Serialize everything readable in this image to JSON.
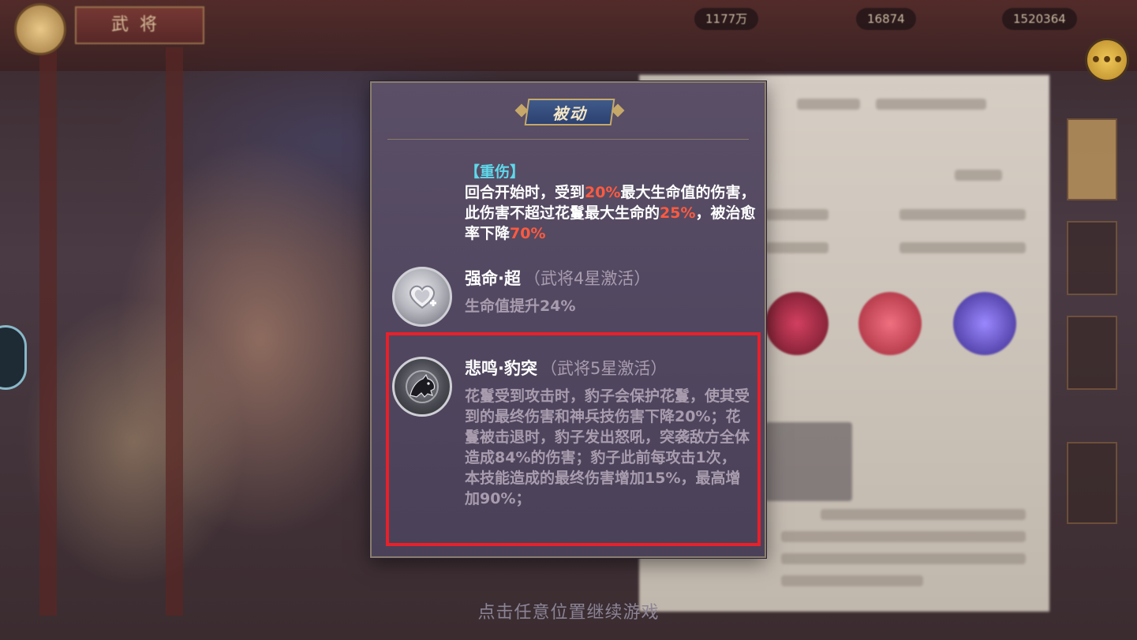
{
  "background": {
    "title_banner": "武将",
    "resources": [
      "1177万",
      "16874",
      "1520364"
    ],
    "hint": "点击任意位置继续游戏"
  },
  "modal": {
    "title": "被动",
    "skill": {
      "tag": "【重伤】",
      "desc_parts": [
        {
          "text": "回合开始时，受到",
          "color": "white"
        },
        {
          "text": "20%",
          "color": "red"
        },
        {
          "text": "最大生命值的伤害，此伤害不超过花鬘最大生命的",
          "color": "white"
        },
        {
          "text": "25%",
          "color": "red"
        },
        {
          "text": "，被治愈率下降",
          "color": "white"
        },
        {
          "text": "70%",
          "color": "red"
        }
      ]
    },
    "entries": [
      {
        "name": "强命·超",
        "condition": "（武将4星激活）",
        "description": "生命值提升24%",
        "icon": "heart-plus-icon"
      },
      {
        "name": "悲鸣·豹突",
        "condition": "（武将5星激活）",
        "description": "花鬘受到攻击时，豹子会保护花鬘，使其受到的最终伤害和神兵技伤害下降20%；花鬘被击退时，豹子发出怒吼，突袭敌方全体造成84%的伤害；豹子此前每攻击1次，本技能造成的最终伤害增加15%，最高增加90%；",
        "icon": "leopard-icon"
      }
    ]
  },
  "colors": {
    "accent_cyan": "#5fd8ea",
    "highlight_red": "#ff5a40",
    "annotation_box": "#e8202a"
  }
}
